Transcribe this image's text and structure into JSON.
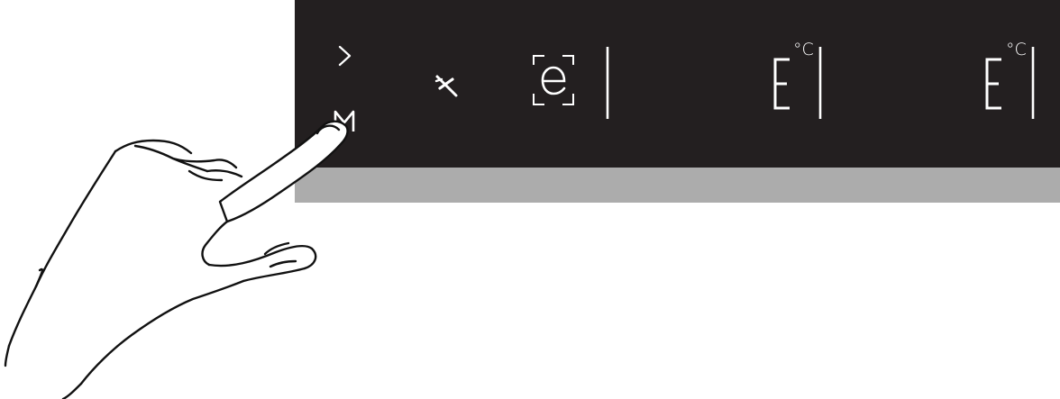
{
  "panel": {
    "display_color": "#231f20",
    "strip_color": "#acacac",
    "symbol_color": "#ffffff"
  },
  "controls": [
    {
      "name": "next-arrow",
      "icon": "chevron-right-icon"
    },
    {
      "name": "menu-key",
      "icon": "m-key-icon"
    },
    {
      "name": "eco-mode",
      "icon": "airplane-icon"
    },
    {
      "name": "eco-zone-display",
      "icon": "e-framed-icon"
    },
    {
      "name": "temperature-display-1",
      "icon": "segment-e-icon",
      "unit": "°C"
    },
    {
      "name": "temperature-display-2",
      "icon": "segment-e-icon",
      "unit": "°C"
    }
  ],
  "hand": {
    "icon": "pointing-hand-icon",
    "action": "touch"
  }
}
